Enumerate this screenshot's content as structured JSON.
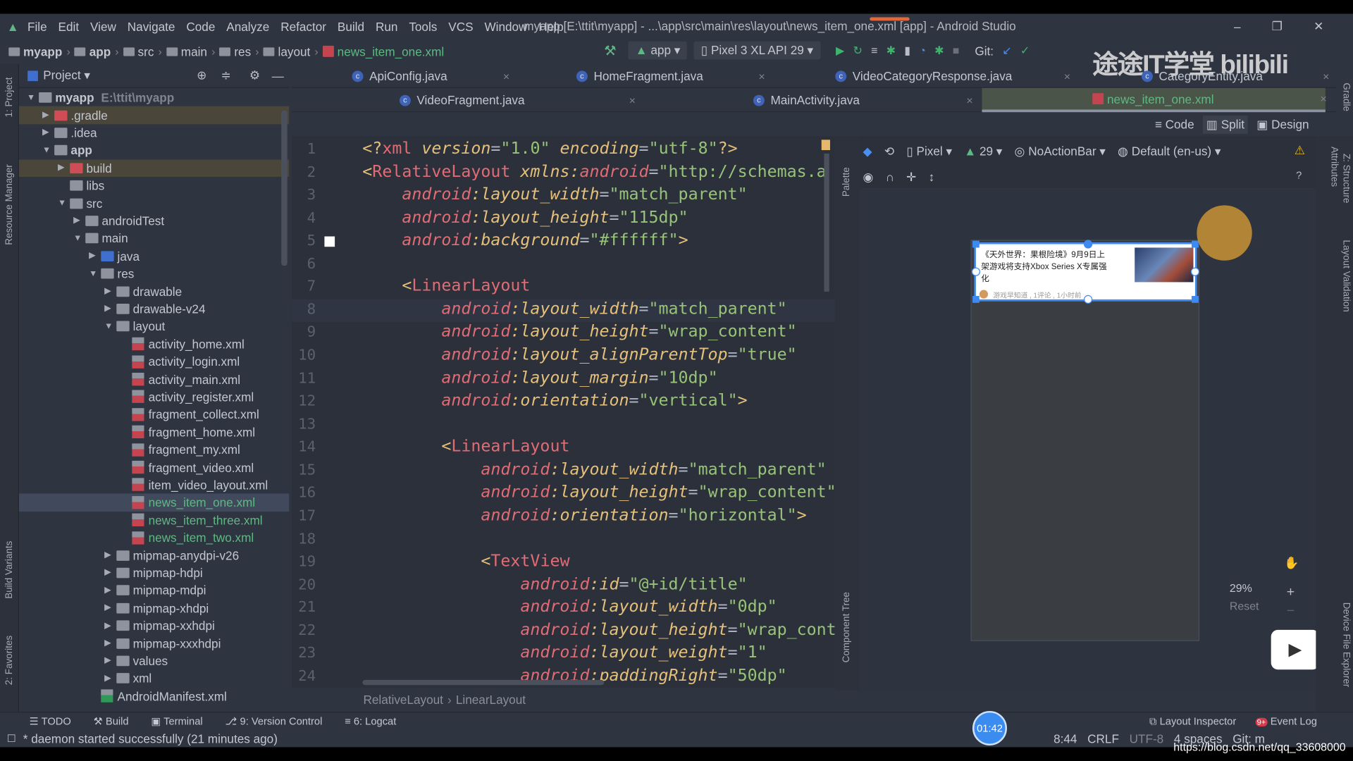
{
  "window": {
    "title": "myapp [E:\\ttit\\myapp] - ...\\app\\src\\main\\res\\layout\\news_item_one.xml [app] - Android Studio",
    "minimize": "–",
    "restore": "❐",
    "close": "✕"
  },
  "menu": [
    "File",
    "Edit",
    "View",
    "Navigate",
    "Code",
    "Analyze",
    "Refactor",
    "Build",
    "Run",
    "Tools",
    "VCS",
    "Window",
    "Help"
  ],
  "breadcrumb": [
    "myapp",
    "app",
    "src",
    "main",
    "res",
    "layout",
    "news_item_one.xml"
  ],
  "toolbar": {
    "config": "app",
    "device": "Pixel 3 XL API 29",
    "git_label": "Git:"
  },
  "watermark": "途途IT学堂 bilibili",
  "left_strip": {
    "project": "1: Project",
    "resource_manager": "Resource Manager",
    "build_variants": "Build Variants",
    "favorites": "2: Favorites"
  },
  "project_panel": {
    "title": "Project",
    "root_hint": "E:\\ttit\\myapp",
    "items": [
      {
        "label": "myapp",
        "depth": 0,
        "expanded": true,
        "icon": "module",
        "bold": true
      },
      {
        "label": ".gradle",
        "depth": 1,
        "expanded": false,
        "icon": "folder-red",
        "ignored": true
      },
      {
        "label": ".idea",
        "depth": 1,
        "expanded": false,
        "icon": "folder"
      },
      {
        "label": "app",
        "depth": 1,
        "expanded": true,
        "icon": "module",
        "bold": true
      },
      {
        "label": "build",
        "depth": 2,
        "expanded": false,
        "icon": "folder-red",
        "ignored": true
      },
      {
        "label": "libs",
        "depth": 2,
        "icon": "folder"
      },
      {
        "label": "src",
        "depth": 2,
        "expanded": true,
        "icon": "folder"
      },
      {
        "label": "androidTest",
        "depth": 3,
        "expanded": false,
        "icon": "folder"
      },
      {
        "label": "main",
        "depth": 3,
        "expanded": true,
        "icon": "folder"
      },
      {
        "label": "java",
        "depth": 4,
        "expanded": false,
        "icon": "folder-blue"
      },
      {
        "label": "res",
        "depth": 4,
        "expanded": true,
        "icon": "folder"
      },
      {
        "label": "drawable",
        "depth": 5,
        "expanded": false,
        "icon": "folder"
      },
      {
        "label": "drawable-v24",
        "depth": 5,
        "expanded": false,
        "icon": "folder"
      },
      {
        "label": "layout",
        "depth": 5,
        "expanded": true,
        "icon": "folder"
      },
      {
        "label": "activity_home.xml",
        "depth": 6,
        "icon": "xml"
      },
      {
        "label": "activity_login.xml",
        "depth": 6,
        "icon": "xml"
      },
      {
        "label": "activity_main.xml",
        "depth": 6,
        "icon": "xml"
      },
      {
        "label": "activity_register.xml",
        "depth": 6,
        "icon": "xml"
      },
      {
        "label": "fragment_collect.xml",
        "depth": 6,
        "icon": "xml"
      },
      {
        "label": "fragment_home.xml",
        "depth": 6,
        "icon": "xml"
      },
      {
        "label": "fragment_my.xml",
        "depth": 6,
        "icon": "xml"
      },
      {
        "label": "fragment_video.xml",
        "depth": 6,
        "icon": "xml"
      },
      {
        "label": "item_video_layout.xml",
        "depth": 6,
        "icon": "xml"
      },
      {
        "label": "news_item_one.xml",
        "depth": 6,
        "icon": "xml",
        "new": true,
        "selected": true
      },
      {
        "label": "news_item_three.xml",
        "depth": 6,
        "icon": "xml",
        "new": true
      },
      {
        "label": "news_item_two.xml",
        "depth": 6,
        "icon": "xml",
        "new": true
      },
      {
        "label": "mipmap-anydpi-v26",
        "depth": 5,
        "expanded": false,
        "icon": "folder"
      },
      {
        "label": "mipmap-hdpi",
        "depth": 5,
        "expanded": false,
        "icon": "folder"
      },
      {
        "label": "mipmap-mdpi",
        "depth": 5,
        "expanded": false,
        "icon": "folder"
      },
      {
        "label": "mipmap-xhdpi",
        "depth": 5,
        "expanded": false,
        "icon": "folder"
      },
      {
        "label": "mipmap-xxhdpi",
        "depth": 5,
        "expanded": false,
        "icon": "folder"
      },
      {
        "label": "mipmap-xxxhdpi",
        "depth": 5,
        "expanded": false,
        "icon": "folder"
      },
      {
        "label": "values",
        "depth": 5,
        "expanded": false,
        "icon": "folder"
      },
      {
        "label": "xml",
        "depth": 5,
        "expanded": false,
        "icon": "folder"
      },
      {
        "label": "AndroidManifest.xml",
        "depth": 4,
        "icon": "manifest"
      }
    ]
  },
  "tabs_row1": [
    {
      "label": "ApiConfig.java"
    },
    {
      "label": "HomeFragment.java"
    },
    {
      "label": "VideoCategoryResponse.java"
    },
    {
      "label": "CategoryEntity.java"
    }
  ],
  "tabs_row2": [
    {
      "label": "VideoFragment.java"
    },
    {
      "label": "MainActivity.java"
    },
    {
      "label": "news_item_one.xml",
      "active": true
    }
  ],
  "view_modes": {
    "code": "Code",
    "split": "Split",
    "design": "Design",
    "selected": "Split"
  },
  "editor": {
    "current_line": 8,
    "lines": [
      [
        [
          "p",
          "<?"
        ],
        [
          "t",
          "xml "
        ],
        [
          "a",
          "version"
        ],
        [
          "o",
          "="
        ],
        [
          "v",
          "\"1.0\" "
        ],
        [
          "a",
          "encoding"
        ],
        [
          "o",
          "="
        ],
        [
          "v",
          "\"utf-8\""
        ],
        [
          "p",
          "?>"
        ]
      ],
      [
        [
          "p",
          "<"
        ],
        [
          "t",
          "RelativeLayout "
        ],
        [
          "a",
          "xmlns:"
        ],
        [
          "n",
          "android"
        ],
        [
          "o",
          "="
        ],
        [
          "v",
          "\"http://schemas.a"
        ]
      ],
      [
        [
          "o",
          "    "
        ],
        [
          "n",
          "android"
        ],
        [
          "a",
          ":layout_width"
        ],
        [
          "o",
          "="
        ],
        [
          "v",
          "\"match_parent\""
        ]
      ],
      [
        [
          "o",
          "    "
        ],
        [
          "n",
          "android"
        ],
        [
          "a",
          ":layout_height"
        ],
        [
          "o",
          "="
        ],
        [
          "v",
          "\"115dp\""
        ]
      ],
      [
        [
          "o",
          "    "
        ],
        [
          "n",
          "android"
        ],
        [
          "a",
          ":background"
        ],
        [
          "o",
          "="
        ],
        [
          "v",
          "\"#ffffff\""
        ],
        [
          "p",
          ">"
        ]
      ],
      [],
      [
        [
          "o",
          "    "
        ],
        [
          "p",
          "<"
        ],
        [
          "t",
          "LinearLayout"
        ]
      ],
      [
        [
          "o",
          "        "
        ],
        [
          "n",
          "android"
        ],
        [
          "a",
          ":layout_width"
        ],
        [
          "o",
          "="
        ],
        [
          "v",
          "\"match_parent\""
        ]
      ],
      [
        [
          "o",
          "        "
        ],
        [
          "n",
          "android"
        ],
        [
          "a",
          ":layout_height"
        ],
        [
          "o",
          "="
        ],
        [
          "v",
          "\"wrap_content\""
        ]
      ],
      [
        [
          "o",
          "        "
        ],
        [
          "n",
          "android"
        ],
        [
          "a",
          ":layout_alignParentTop"
        ],
        [
          "o",
          "="
        ],
        [
          "v",
          "\"true\""
        ]
      ],
      [
        [
          "o",
          "        "
        ],
        [
          "n",
          "android"
        ],
        [
          "a",
          ":layout_margin"
        ],
        [
          "o",
          "="
        ],
        [
          "v",
          "\"10dp\""
        ]
      ],
      [
        [
          "o",
          "        "
        ],
        [
          "n",
          "android"
        ],
        [
          "a",
          ":orientation"
        ],
        [
          "o",
          "="
        ],
        [
          "v",
          "\"vertical\""
        ],
        [
          "p",
          ">"
        ]
      ],
      [],
      [
        [
          "o",
          "        "
        ],
        [
          "p",
          "<"
        ],
        [
          "t",
          "LinearLayout"
        ]
      ],
      [
        [
          "o",
          "            "
        ],
        [
          "n",
          "android"
        ],
        [
          "a",
          ":layout_width"
        ],
        [
          "o",
          "="
        ],
        [
          "v",
          "\"match_parent\""
        ]
      ],
      [
        [
          "o",
          "            "
        ],
        [
          "n",
          "android"
        ],
        [
          "a",
          ":layout_height"
        ],
        [
          "o",
          "="
        ],
        [
          "v",
          "\"wrap_content\""
        ]
      ],
      [
        [
          "o",
          "            "
        ],
        [
          "n",
          "android"
        ],
        [
          "a",
          ":orientation"
        ],
        [
          "o",
          "="
        ],
        [
          "v",
          "\"horizontal\""
        ],
        [
          "p",
          ">"
        ]
      ],
      [],
      [
        [
          "o",
          "            "
        ],
        [
          "p",
          "<"
        ],
        [
          "t",
          "TextView"
        ]
      ],
      [
        [
          "o",
          "                "
        ],
        [
          "n",
          "android"
        ],
        [
          "a",
          ":id"
        ],
        [
          "o",
          "="
        ],
        [
          "v",
          "\"@+id/title\""
        ]
      ],
      [
        [
          "o",
          "                "
        ],
        [
          "n",
          "android"
        ],
        [
          "a",
          ":layout_width"
        ],
        [
          "o",
          "="
        ],
        [
          "v",
          "\"0dp\""
        ]
      ],
      [
        [
          "o",
          "                "
        ],
        [
          "n",
          "android"
        ],
        [
          "a",
          ":layout_height"
        ],
        [
          "o",
          "="
        ],
        [
          "v",
          "\"wrap_cont"
        ]
      ],
      [
        [
          "o",
          "                "
        ],
        [
          "n",
          "android"
        ],
        [
          "a",
          ":layout_weight"
        ],
        [
          "o",
          "="
        ],
        [
          "v",
          "\"1\""
        ]
      ],
      [
        [
          "o",
          "                "
        ],
        [
          "n",
          "android"
        ],
        [
          "a",
          ":paddingRight"
        ],
        [
          "o",
          "="
        ],
        [
          "v",
          "\"50dp\""
        ]
      ]
    ]
  },
  "editor_breadcrumb": [
    "RelativeLayout",
    "LinearLayout"
  ],
  "palette_label": "Palette",
  "component_tree_label": "Component Tree",
  "design_toolbar": {
    "device": "Pixel",
    "api": "29",
    "theme": "NoActionBar",
    "locale": "Default (en-us)"
  },
  "preview": {
    "title": "《天外世界：果根险境》9月9日上架游戏将支持Xbox Series X专属强化",
    "meta": "游戏早知道 ,  1评论 ,  1小时前"
  },
  "zoom": {
    "level": "29%",
    "reset": "Reset"
  },
  "right_strip": {
    "gradle": "Gradle",
    "attributes": "Attributes",
    "structure": "Z: Structure",
    "layout_validation": "Layout Validation",
    "device_file_explorer": "Device File Explorer"
  },
  "bottom_tools": [
    "TODO",
    "Build",
    "Terminal",
    "9: Version Control",
    "6: Logcat"
  ],
  "bottom_right": {
    "layout_inspector": "Layout Inspector",
    "event_log": "Event Log",
    "event_badge": "9+"
  },
  "status": {
    "message": "* daemon started successfully (21 minutes ago)",
    "position": "8:44",
    "line_sep": "CRLF",
    "encoding": "UTF-8",
    "indent": "4 spaces",
    "git": "Git: m"
  },
  "timer": "01:42",
  "url_watermark": "https://blog.csdn.net/qq_33608000"
}
